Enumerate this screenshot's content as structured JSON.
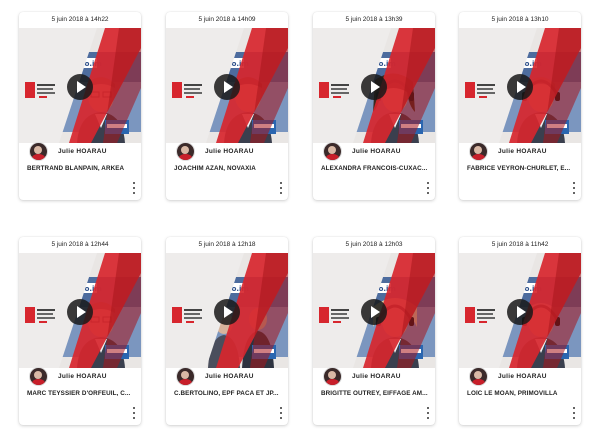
{
  "cards": [
    {
      "date": "5 juin 2018 à 14h22",
      "author": "Julie HOARAU",
      "title": "BERTRAND BLANPAIN, ARKEA",
      "scene": "man-glasses",
      "person_color": "#5a4a44"
    },
    {
      "date": "5 juin 2018 à 14h09",
      "author": "Julie HOARAU",
      "title": "JOACHIM AZAN, NOVAXIA",
      "scene": "man",
      "person_color": "#3a2e2a"
    },
    {
      "date": "5 juin 2018 à 13h39",
      "author": "Julie HOARAU",
      "title": "ALEXANDRA FRANCOIS-CUXAC...",
      "scene": "woman",
      "person_color": "#3a2a20"
    },
    {
      "date": "5 juin 2018 à 13h10",
      "author": "Julie HOARAU",
      "title": "FABRICE VEYRON-CHURLET, E...",
      "scene": "man-headset",
      "person_color": "#6a5a4a"
    },
    {
      "date": "5 juin 2018 à 12h44",
      "author": "Julie HOARAU",
      "title": "MARC TEYSSIER D'ORFEUIL, C...",
      "scene": "man-glasses",
      "person_color": "#5a4a40"
    },
    {
      "date": "5 juin 2018 à 12h18",
      "author": "Julie HOARAU",
      "title": "C.BERTOLINO, EPF PACA ET JP...",
      "scene": "two",
      "person_color": "#6a5040"
    },
    {
      "date": "5 juin 2018 à 12h03",
      "author": "Julie HOARAU",
      "title": "BRIGITTE OUTREY, EIFFAGE AM...",
      "scene": "woman-blonde",
      "person_color": "#d9c9a0"
    },
    {
      "date": "5 juin 2018 à 11h42",
      "author": "Julie HOARAU",
      "title": "LOÏC LE MOAN, PRIMOVILLA",
      "scene": "man-bald",
      "person_color": "#b8a090"
    }
  ],
  "colors": {
    "brand_red": "#d7262e",
    "dark_red": "#a8161c",
    "studio_blue": "#6a8fc0",
    "card_bg": "#ffffff"
  },
  "icons": {
    "play": "play-icon",
    "menu": "more-vert-icon",
    "avatar": "avatar-icon"
  }
}
